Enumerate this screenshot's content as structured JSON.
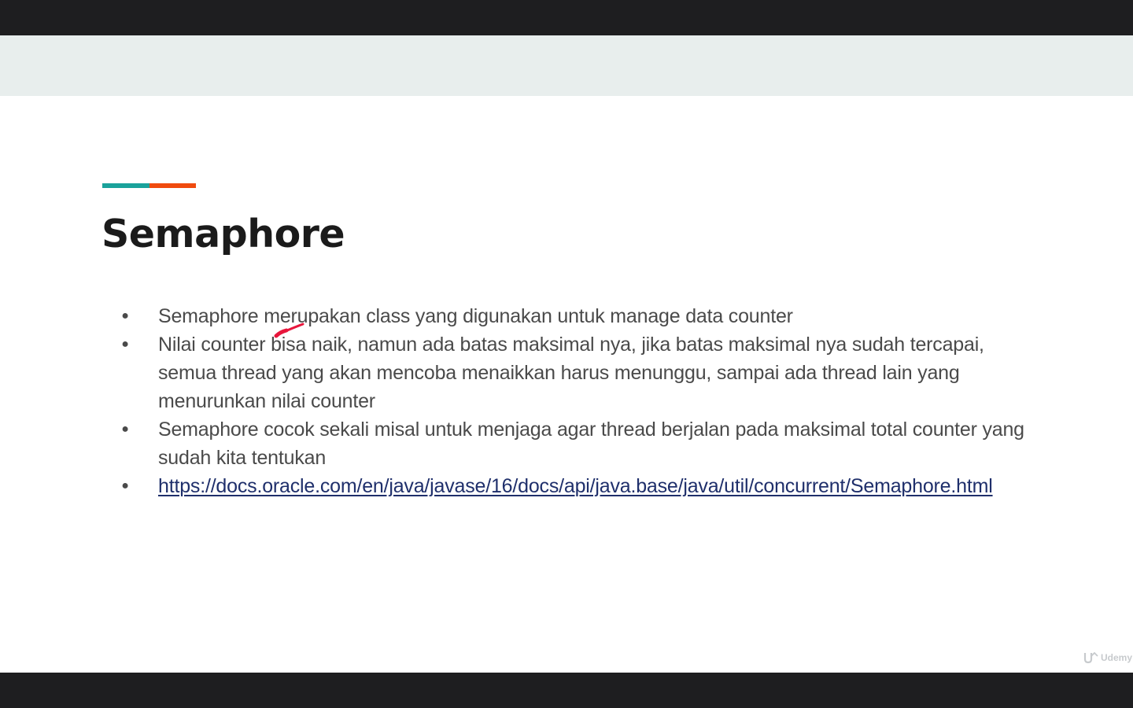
{
  "slide": {
    "title": "Semaphore",
    "accent_colors": {
      "teal": "#1aa29b",
      "orange": "#f04b0e"
    },
    "bullets": [
      {
        "text": "Semaphore merupakan class yang digunakan untuk manage data counter",
        "is_link": false
      },
      {
        "text": "Nilai counter bisa naik, namun ada batas maksimal nya, jika batas maksimal nya sudah tercapai, semua thread yang akan mencoba menaikkan harus menunggu, sampai ada thread lain yang menurunkan nilai counter",
        "is_link": false
      },
      {
        "text": "Semaphore cocok sekali misal untuk menjaga agar thread berjalan pada maksimal total counter yang sudah kita tentukan",
        "is_link": false
      },
      {
        "text": "https://docs.oracle.com/en/java/javase/16/docs/api/java.base/java/util/concurrent/Semaphore.html",
        "is_link": true
      }
    ],
    "bullet_glyph": "●"
  },
  "watermark": {
    "text": "Udemy",
    "icon": "udemy-logo-icon"
  },
  "annotation": {
    "icon": "pen-stroke-icon",
    "color": "#e8163c"
  }
}
